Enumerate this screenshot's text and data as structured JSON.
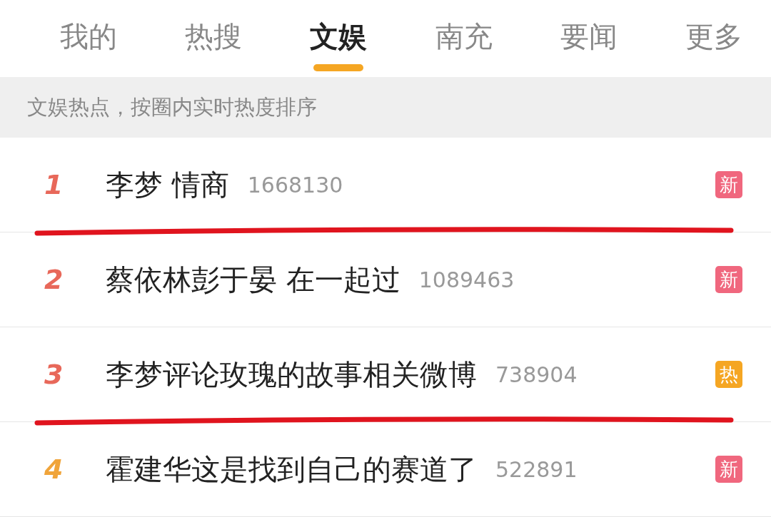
{
  "tabs": [
    {
      "label": "我的",
      "selected": false
    },
    {
      "label": "热搜",
      "selected": false
    },
    {
      "label": "文娱",
      "selected": true
    },
    {
      "label": "南充",
      "selected": false
    },
    {
      "label": "要闻",
      "selected": false
    },
    {
      "label": "更多",
      "selected": false
    }
  ],
  "notice": "文娱热点，按圈内实时热度排序",
  "rows": [
    {
      "rank": "1",
      "color": "#e8685a",
      "title": "李梦 情商",
      "count": "1668130",
      "badge": {
        "kind": "new",
        "label": "新"
      },
      "underlined": true
    },
    {
      "rank": "2",
      "color": "#e8685a",
      "title": "蔡依林彭于晏 在一起过",
      "count": "1089463",
      "badge": {
        "kind": "new",
        "label": "新"
      },
      "underlined": false
    },
    {
      "rank": "3",
      "color": "#e8685a",
      "title": "李梦评论玫瑰的故事相关微博",
      "count": "738904",
      "badge": {
        "kind": "hot",
        "label": "热"
      },
      "underlined": true
    },
    {
      "rank": "4",
      "color": "#f0a43a",
      "title": "霍建华这是找到自己的赛道了",
      "count": "522891",
      "badge": {
        "kind": "new",
        "label": "新"
      },
      "underlined": false
    }
  ]
}
